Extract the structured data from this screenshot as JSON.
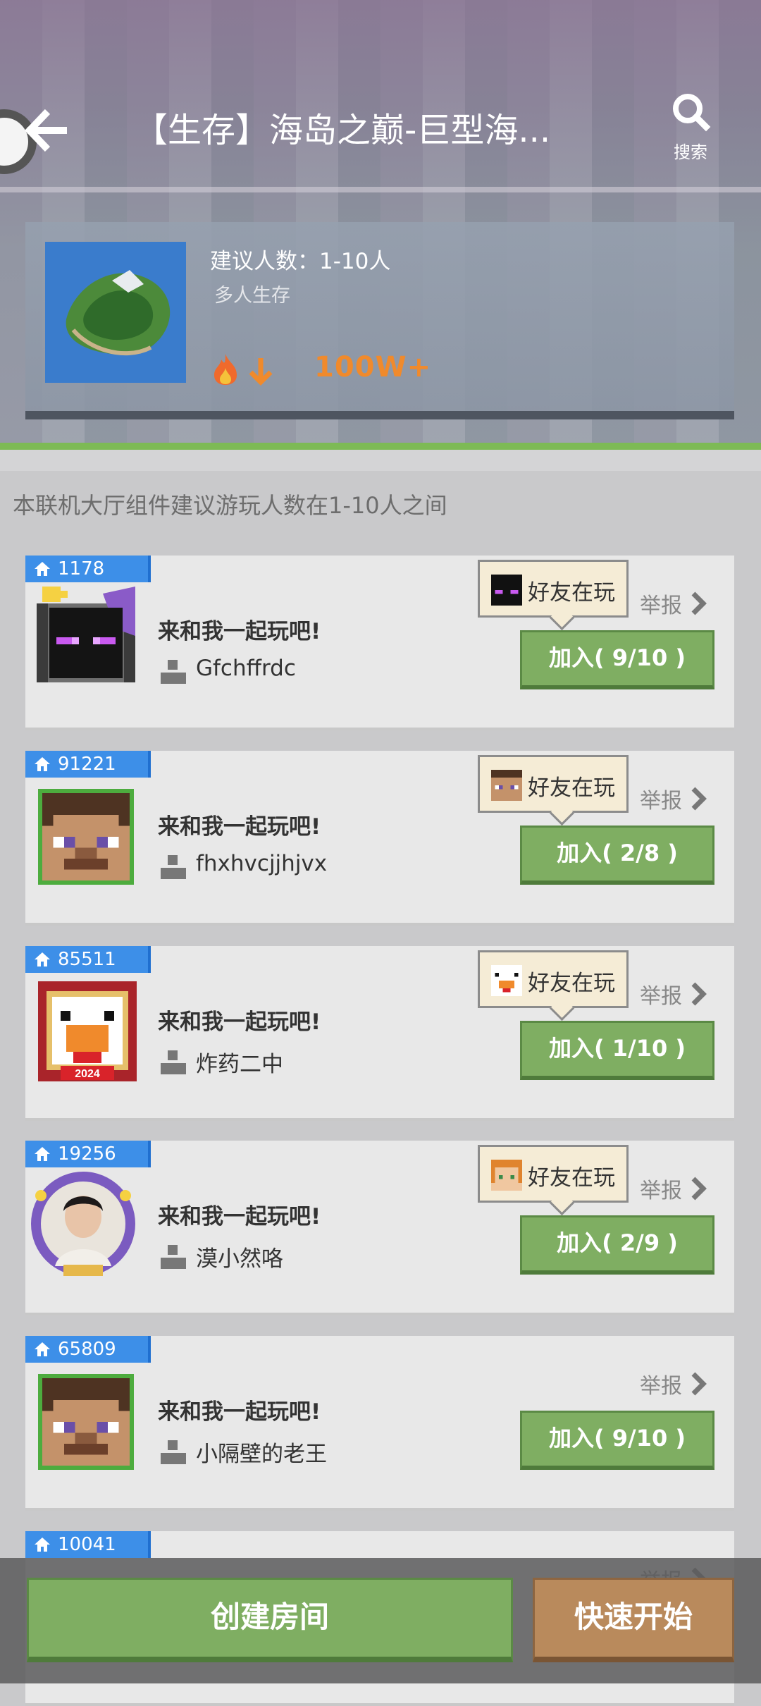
{
  "header": {
    "title": "【生存】海岛之巅-巨型海...",
    "search_label": "搜索"
  },
  "map_card": {
    "recommend_label": "建议人数：1-10人",
    "mode_label": "多人生存",
    "popularity": "100W+"
  },
  "notice": "本联机大厅组件建议游玩人数在1-10人之间",
  "rooms": [
    {
      "id": "1178",
      "name": "来和我一起玩吧!",
      "host": "Gfchffrdc",
      "friend_tag": "好友在玩",
      "report": "举报",
      "join": "加入( 9/10 )",
      "avatar": "enderman-avatar",
      "friend_face": "enderman-face"
    },
    {
      "id": "91221",
      "name": "来和我一起玩吧!",
      "host": "fhxhvcjjhjvx",
      "friend_tag": "好友在玩",
      "report": "举报",
      "join": "加入( 2/8 )",
      "avatar": "steve-avatar",
      "friend_face": "steve-face"
    },
    {
      "id": "85511",
      "name": "来和我一起玩吧!",
      "host": "炸药二中",
      "friend_tag": "好友在玩",
      "report": "举报",
      "join": "加入( 1/10 )",
      "avatar": "chicken-avatar",
      "friend_face": "chicken-face"
    },
    {
      "id": "19256",
      "name": "来和我一起玩吧!",
      "host": "漠小然咯",
      "friend_tag": "好友在玩",
      "report": "举报",
      "join": "加入( 2/9 )",
      "avatar": "photo-avatar",
      "friend_face": "alex-face"
    },
    {
      "id": "65809",
      "name": "来和我一起玩吧!",
      "host": "小隔壁的老王",
      "friend_tag": "",
      "report": "举报",
      "join": "加入( 9/10 )",
      "avatar": "steve-avatar",
      "friend_face": ""
    },
    {
      "id": "10041",
      "name": "",
      "host": "",
      "friend_tag": "",
      "report": "举报",
      "join": "",
      "avatar": "",
      "friend_face": ""
    }
  ],
  "bottom": {
    "create_label": "创建房间",
    "quick_label": "快速开始"
  },
  "colors": {
    "join_green": "#7fae62",
    "id_blue": "#3d8fe8",
    "quick_brown": "#b98a5c",
    "hot_orange": "#f08a2c"
  }
}
